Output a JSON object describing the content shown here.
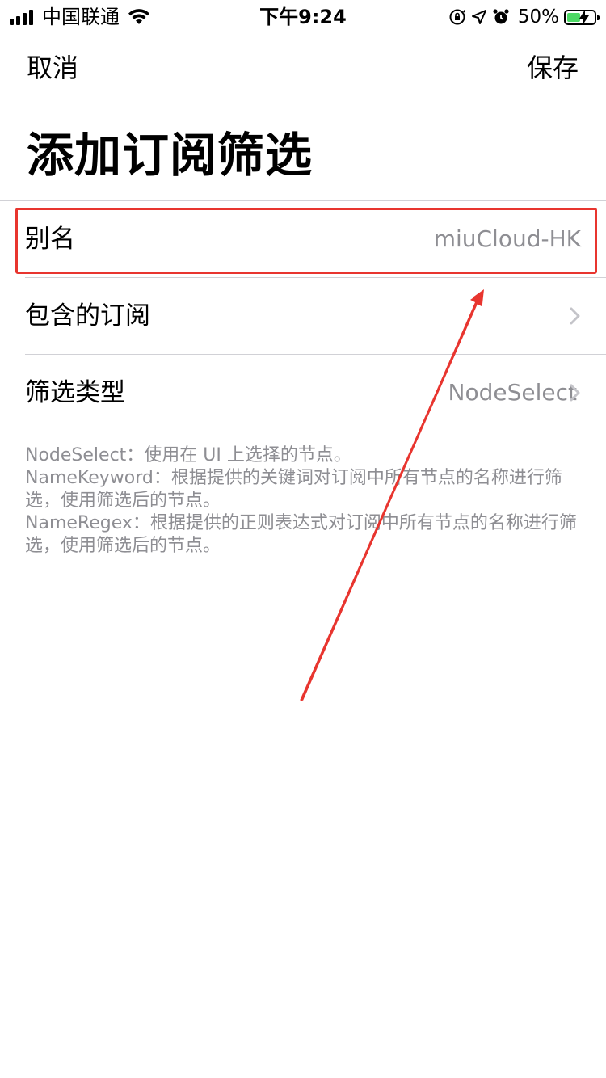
{
  "status_bar": {
    "carrier": "中国联通",
    "time": "下午9:24",
    "battery": "50%",
    "icons": [
      "signal-icon",
      "wifi-icon",
      "orientation-lock-icon",
      "location-icon",
      "alarm-icon",
      "battery-charging-icon"
    ],
    "battery_level": 0.5,
    "battery_color": "#4cd964"
  },
  "nav": {
    "cancel_label": "取消",
    "save_label": "保存"
  },
  "title": "添加订阅筛选",
  "rows": {
    "alias": {
      "label": "别名",
      "value": "miuCloud-HK"
    },
    "subscriptions": {
      "label": "包含的订阅",
      "value": ""
    },
    "filter_type": {
      "label": "筛选类型",
      "value": "NodeSelect"
    }
  },
  "footnote": {
    "lines": [
      "NodeSelect：使用在 UI 上选择的节点。",
      "NameKeyword：根据提供的关键词对订阅中所有节点的名称进行筛选，使用筛选后的节点。",
      "NameRegex：根据提供的正则表达式对订阅中所有节点的名称进行筛选，使用筛选后的节点。"
    ]
  },
  "annotation": {
    "color": "#e8352f",
    "icons": [
      "red-arrow-annotation",
      "red-highlight-box"
    ]
  }
}
